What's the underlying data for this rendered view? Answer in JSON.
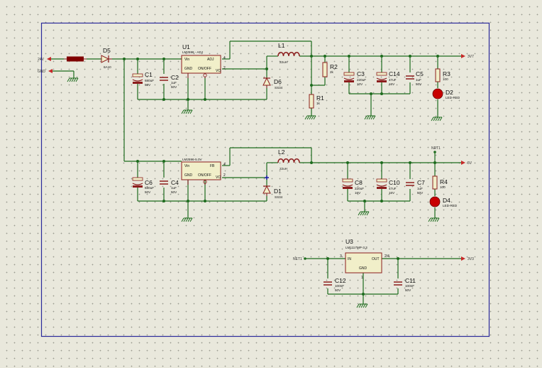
{
  "colors": {
    "background": "#e9e8dc",
    "border": "#2a2a9a",
    "wire": "#1d6b1d",
    "component_outline": "#8c1d1d",
    "component_fill": "#f1efc9",
    "led": "#c80000",
    "fuse": "#800000"
  },
  "terminals": {
    "in_24v": "24V",
    "gnd": "GND",
    "out_3v7": "3V7",
    "out_5v": "5V",
    "out_3v3": "3V3"
  },
  "net_labels": {
    "net1_top": "NET1",
    "net1_left": "NET1"
  },
  "d5": {
    "ref": "D5",
    "value": "6A10"
  },
  "u1": {
    "ref": "U1",
    "part": "LM2596 - ADJ",
    "pin_vin": "Vin",
    "pin_adj": "ADJ",
    "pin_gnd": "GND",
    "pin_onoff": "ON/OFF",
    "pin_vo": "VO",
    "pin_num_vin": "5",
    "pin_num_adj": "4",
    "pin_num_vo": "2"
  },
  "c1": {
    "ref": "C1",
    "value": "680uF",
    "voltage": "50V"
  },
  "c2": {
    "ref": "C2",
    "value": "1uF",
    "voltage": "50V"
  },
  "l1": {
    "ref": "L1",
    "value": "22uH"
  },
  "d6": {
    "ref": "D6",
    "value": "SS34"
  },
  "r1": {
    "ref": "R1",
    "value": "1k"
  },
  "r2": {
    "ref": "R2",
    "value": "2k"
  },
  "c3": {
    "ref": "C3",
    "value": "220uF",
    "voltage": "10V"
  },
  "c14": {
    "ref": "C14",
    "value": "47uF",
    "voltage": "16V"
  },
  "c5": {
    "ref": "C5",
    "value": "1uF",
    "voltage": "50V"
  },
  "r3": {
    "ref": "R3",
    "value": "100"
  },
  "d2": {
    "ref": "D2",
    "value": "LED-RED"
  },
  "u2": {
    "part": "LM2596-5.0V",
    "pin_vin": "Vin",
    "pin_fb": "FB",
    "pin_gnd": "GND",
    "pin_onoff": "ON/OFF",
    "pin_vo": "VO",
    "pin_num_vin": "5",
    "pin_num_fb": "4",
    "pin_num_vo": "2"
  },
  "c6": {
    "ref": "C6",
    "value": "680uF",
    "voltage": "50V"
  },
  "c4": {
    "ref": "C4",
    "value": "1uF",
    "voltage": "50V"
  },
  "l2": {
    "ref": "L2",
    "value": "22uH"
  },
  "d1": {
    "ref": "D1",
    "value": "SS34"
  },
  "c8": {
    "ref": "C8",
    "value": "220uF",
    "voltage": "16V"
  },
  "c10": {
    "ref": "C10",
    "value": "47uF",
    "voltage": "16V"
  },
  "c7": {
    "ref": "C7",
    "value": "1uF",
    "voltage": "50V"
  },
  "r4": {
    "ref": "R4",
    "value": "100"
  },
  "d4": {
    "ref": "D4",
    "value": "LED-RED"
  },
  "u3": {
    "ref": "U3",
    "part": "LM1117MP-3.3",
    "pin_in": "IN",
    "pin_out": "OUT",
    "pin_gnd": "GND",
    "pin_num_in": "3",
    "pin_num_out": "2/4",
    "pin_num_gnd": "1"
  },
  "c12": {
    "ref": "C12",
    "value": "100nF",
    "voltage": "50V"
  },
  "c11": {
    "ref": "C11",
    "value": "100nF",
    "voltage": "50V"
  }
}
